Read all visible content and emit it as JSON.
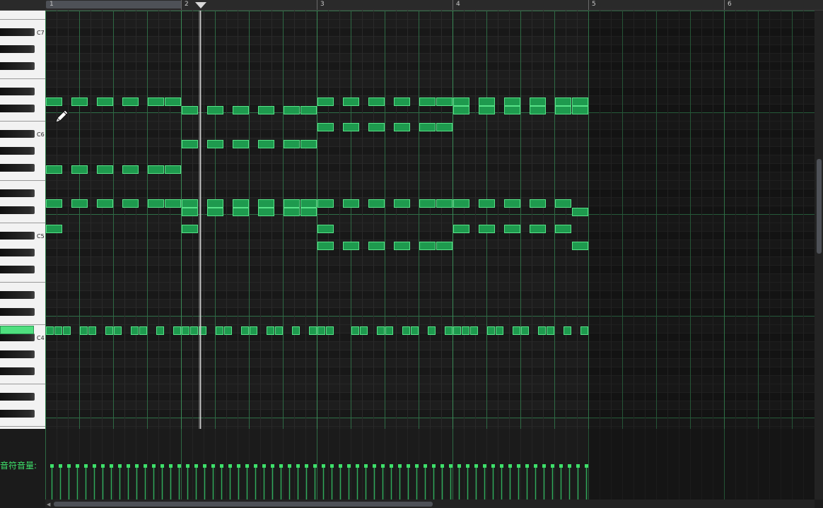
{
  "ruler": {
    "bars": [
      "1",
      "2",
      "3",
      "4",
      "5",
      "6"
    ]
  },
  "piano": {
    "octave_labels": [
      "C7",
      "C6",
      "C5",
      "C4"
    ],
    "active_key": "C4"
  },
  "velocity": {
    "label": "音符音量:"
  },
  "tool": {
    "cursor_icon": "pencil-icon"
  },
  "colors": {
    "note_fill": "#1e9a4e",
    "note_border": "#58e288",
    "grid_bar": "#3a8a56",
    "accent": "#3ee06a"
  }
}
